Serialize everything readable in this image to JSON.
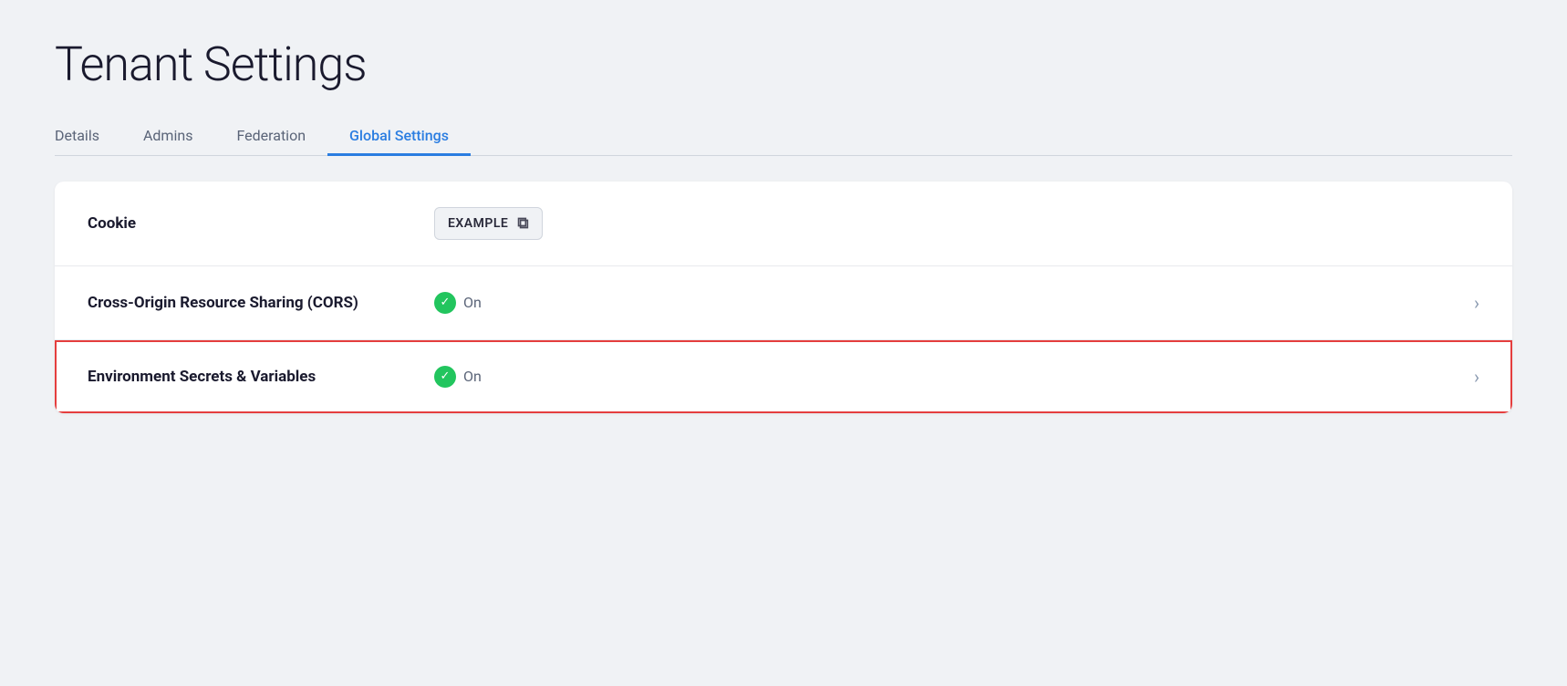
{
  "page": {
    "title": "Tenant Settings"
  },
  "tabs": [
    {
      "id": "details",
      "label": "Details",
      "active": false
    },
    {
      "id": "admins",
      "label": "Admins",
      "active": false
    },
    {
      "id": "federation",
      "label": "Federation",
      "active": false
    },
    {
      "id": "global-settings",
      "label": "Global Settings",
      "active": true
    }
  ],
  "rows": [
    {
      "id": "cookie",
      "label": "Cookie",
      "type": "cookie",
      "cookie_value": "EXAMPLE",
      "highlighted": false
    },
    {
      "id": "cors",
      "label": "Cross-Origin Resource Sharing (CORS)",
      "type": "status",
      "status": "On",
      "highlighted": false,
      "has_chevron": true
    },
    {
      "id": "env-secrets",
      "label": "Environment Secrets & Variables",
      "type": "status",
      "status": "On",
      "highlighted": true,
      "has_chevron": true
    }
  ],
  "icons": {
    "copy": "⧉",
    "check": "✓",
    "chevron": "›"
  }
}
